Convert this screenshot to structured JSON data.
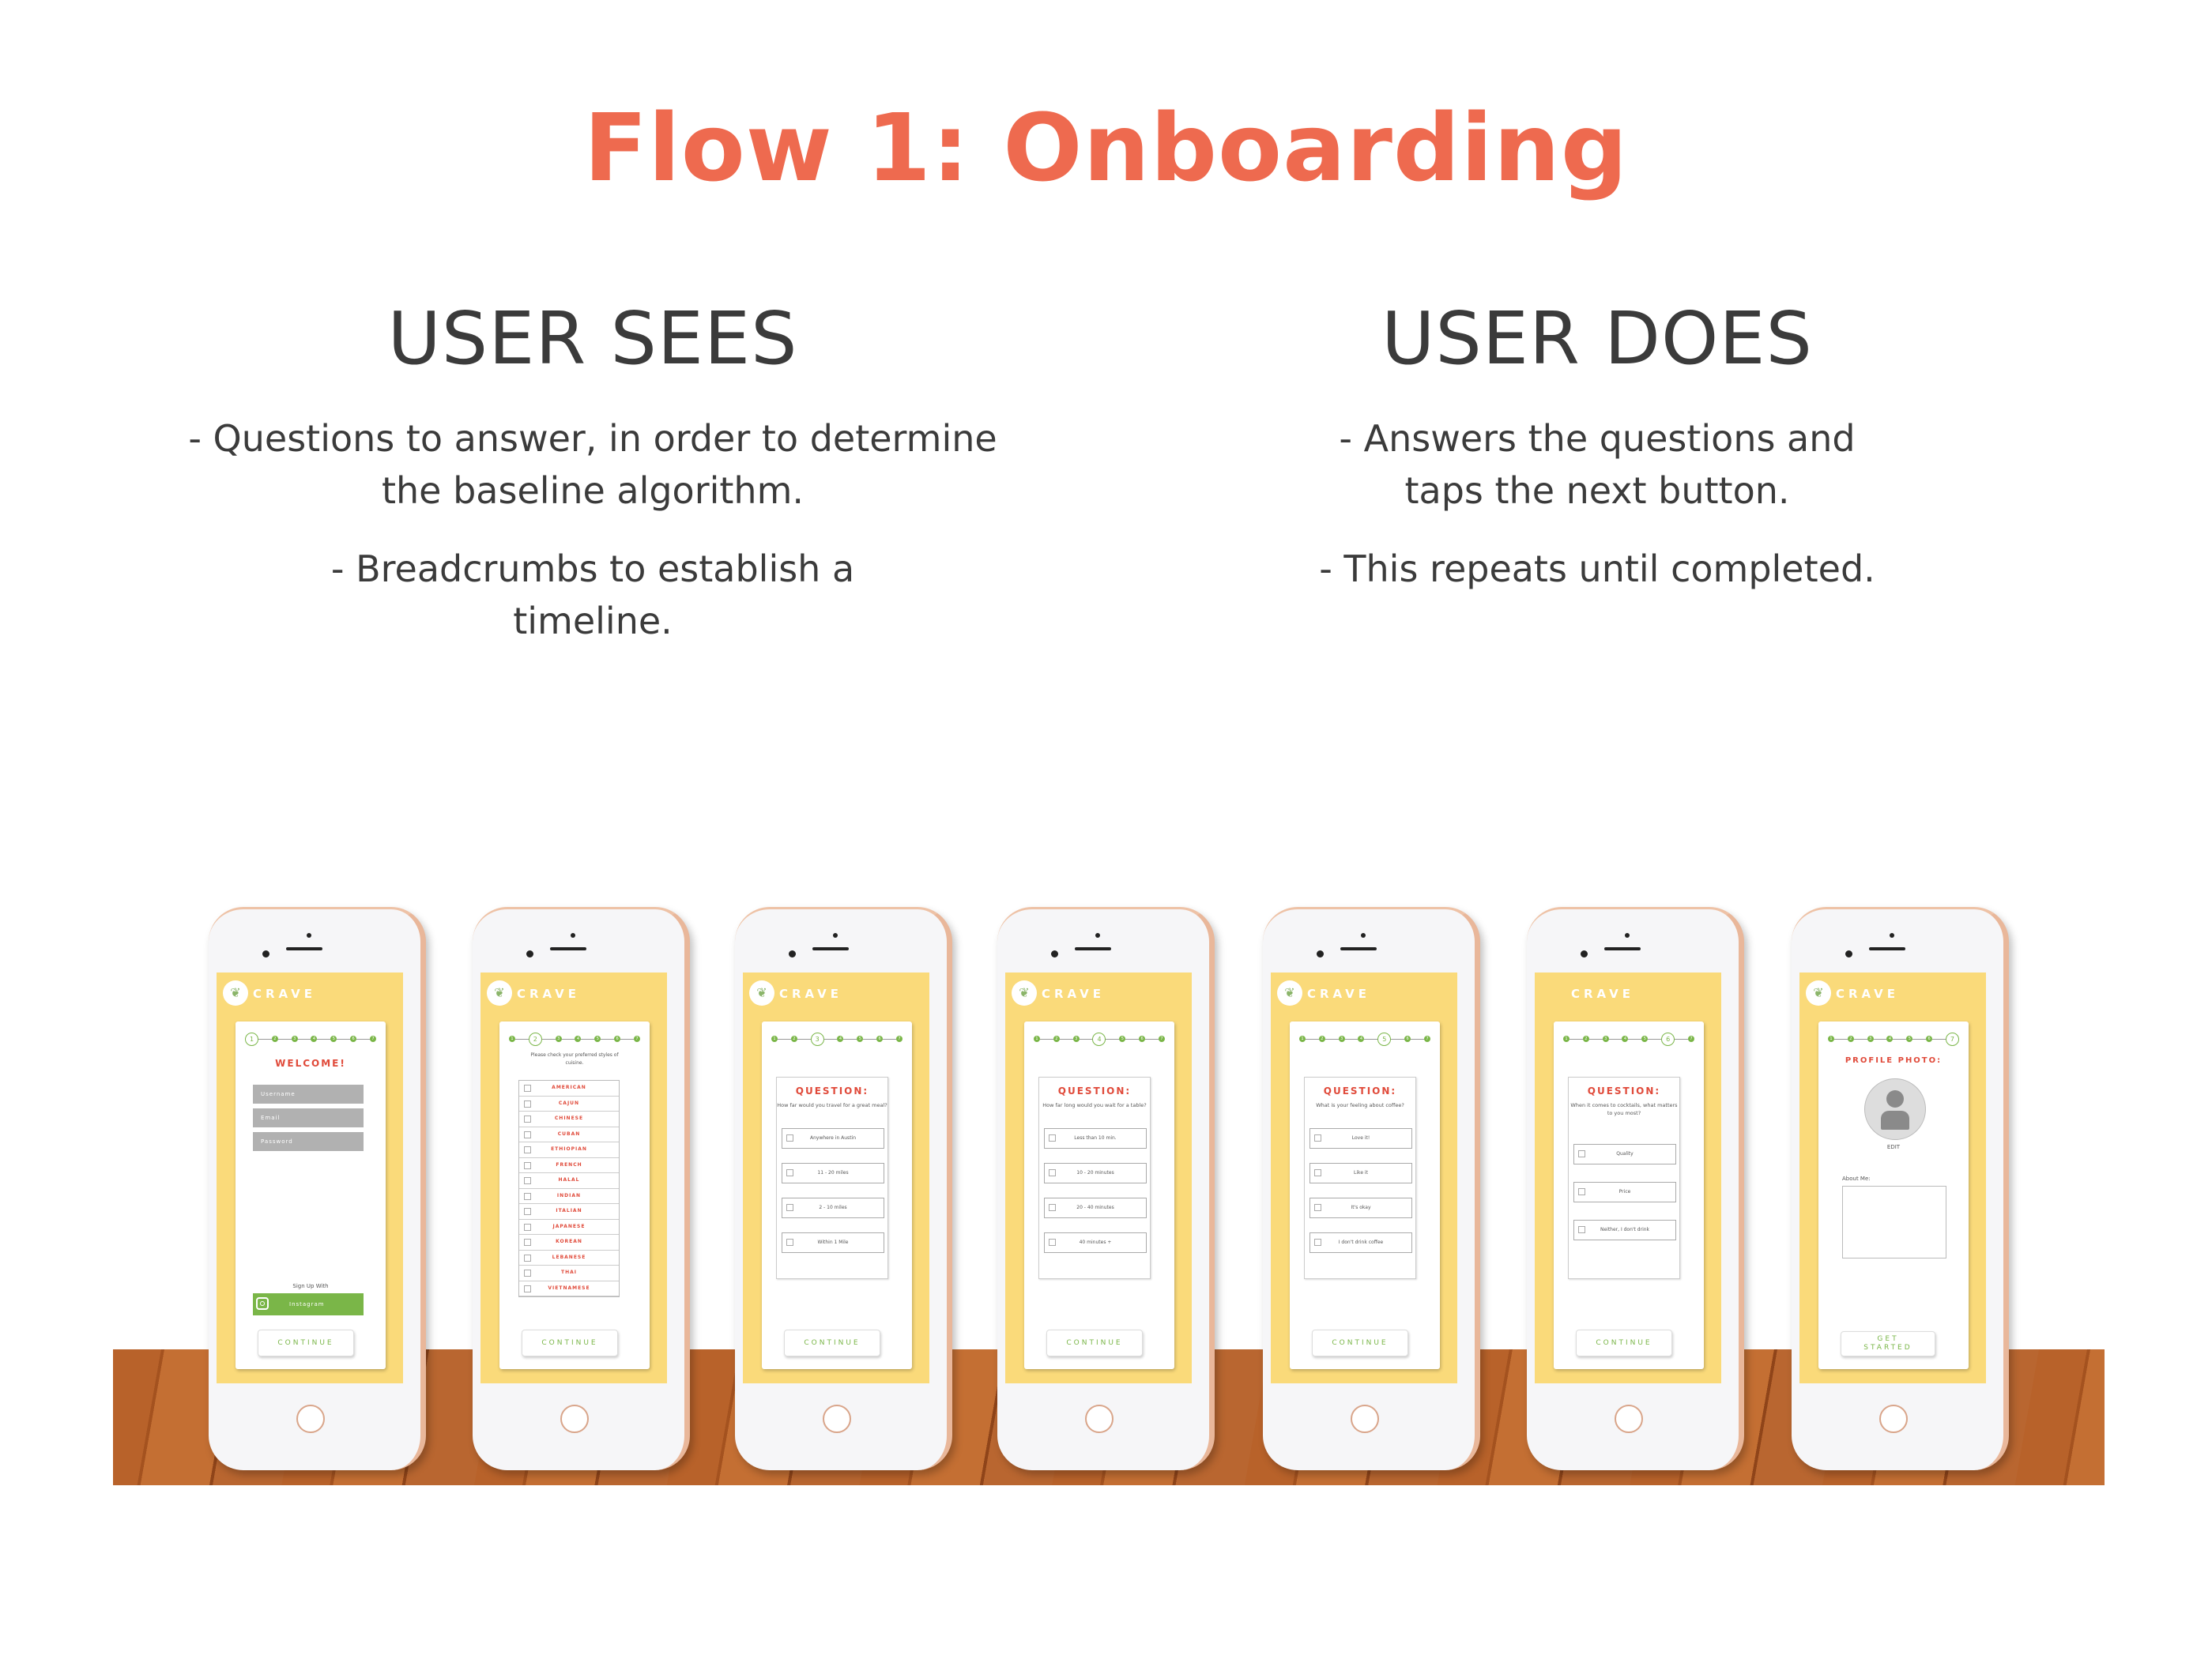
{
  "title": "Flow 1: Onboarding",
  "user_sees": {
    "heading": "USER SEES",
    "bullets": [
      "-  Questions  to answer, in order to determine the baseline algorithm.",
      "-  Breadcrumbs to establish a timeline."
    ]
  },
  "user_does": {
    "heading": "USER DOES",
    "bullets": [
      "-  Answers the questions and taps the next button.",
      "-  This repeats until completed."
    ]
  },
  "colors": {
    "title": "#EE6A4F",
    "screen": "#FADA7A",
    "accent_green": "#7AB648",
    "accent_red": "#E04A3A"
  },
  "brand": "CRAVE",
  "total_steps": 7,
  "phones": [
    {
      "type": "welcome",
      "step": 1,
      "heading": "WELCOME!",
      "fields": [
        "Username",
        "Email",
        "Password"
      ],
      "signup_label": "Sign Up With",
      "instagram_label": "Instagram",
      "button": "CONTINUE",
      "show_logo": true
    },
    {
      "type": "cuisine",
      "step": 2,
      "prompt": "Please check your preferred styles of cuisine.",
      "options": [
        "AMERICAN",
        "CAJUN",
        "CHINESE",
        "CUBAN",
        "ETHIOPIAN",
        "FRENCH",
        "HALAL",
        "INDIAN",
        "ITALIAN",
        "JAPANESE",
        "KOREAN",
        "LEBANESE",
        "THAI",
        "VIETNAMESE"
      ],
      "button": "CONTINUE",
      "show_logo": true
    },
    {
      "type": "question",
      "step": 3,
      "heading": "QUESTION:",
      "prompt": "How far would you travel for a great meal?",
      "options": [
        "Anywhere in Austin",
        "11 - 20 miles",
        "2 - 10 miles",
        "Within 1 Mile"
      ],
      "button": "CONTINUE",
      "show_logo": true
    },
    {
      "type": "question",
      "step": 4,
      "heading": "QUESTION:",
      "prompt": "How far long would you wait for a table?",
      "options": [
        "Less than 10 min.",
        "10 - 20 minutes",
        "20 - 40 minutes",
        "40 minutes +"
      ],
      "button": "CONTINUE",
      "show_logo": true
    },
    {
      "type": "question",
      "step": 5,
      "heading": "QUESTION:",
      "prompt": "What is your feeling about coffee?",
      "options": [
        "Love it!",
        "Like it",
        "It's okay",
        "I don't drink coffee"
      ],
      "button": "CONTINUE",
      "show_logo": true
    },
    {
      "type": "question",
      "step": 6,
      "heading": "QUESTION:",
      "prompt": "When it comes to cocktails, what matters to you most?",
      "options": [
        "Quality",
        "Price",
        "Neither, I don't drink"
      ],
      "button": "CONTINUE",
      "show_logo": false
    },
    {
      "type": "profile",
      "step": 7,
      "heading": "PROFILE PHOTO:",
      "edit_label": "EDIT",
      "about_label": "About Me:",
      "button": "GET STARTED",
      "show_logo": true
    }
  ]
}
